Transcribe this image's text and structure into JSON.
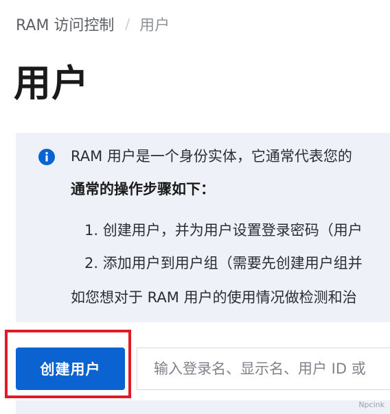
{
  "breadcrumb": {
    "root": "RAM 访问控制",
    "separator": "/",
    "current": "用户"
  },
  "page": {
    "title": "用户"
  },
  "info": {
    "icon": "info-icon",
    "line1": "RAM 用户是一个身份实体，它通常代表您的",
    "heading": "通常的操作步骤如下：",
    "step1": "1. 创建用户，并为用户设置登录密码（用户",
    "step2": "2. 添加用户到用户组（需要先创建用户组并",
    "line_last": "如您想对于 RAM 用户的使用情况做检测和治"
  },
  "toolbar": {
    "create_label": "创建用户",
    "search_placeholder": "输入登录名、显示名、用户 ID 或"
  },
  "watermark": "Npcink",
  "colors": {
    "primary": "#0a63d0",
    "highlight": "#e11b24",
    "info_bg": "#eef1f7"
  }
}
